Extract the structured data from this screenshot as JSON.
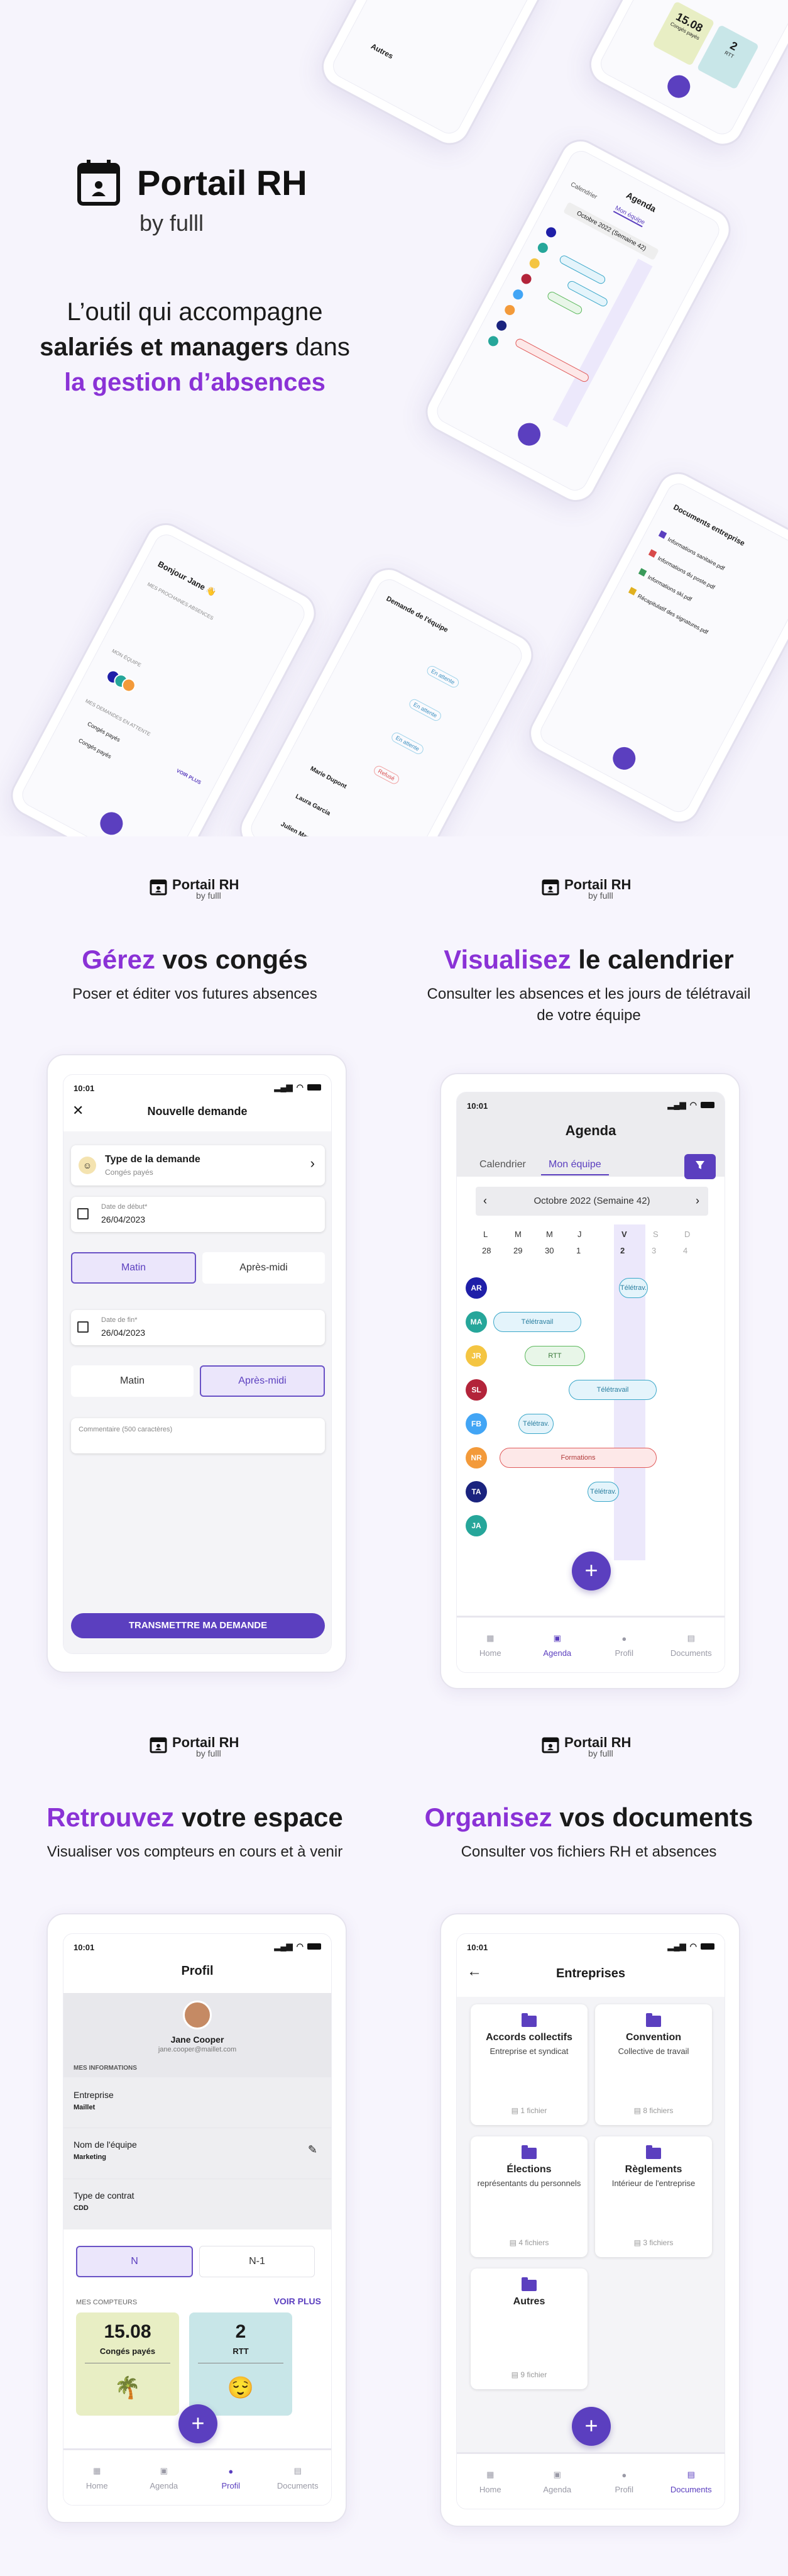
{
  "hero": {
    "brand": "Portail RH",
    "by": "by fulll",
    "tag1": "L’outil qui accompagne",
    "tag2a": "salariés et managers",
    "tag2b": " dans",
    "tag3": "la gestion d’absences",
    "deco": {
      "agenda_title": "Agenda",
      "agenda_tabs": [
        "Calendrier",
        "Mon équipe"
      ],
      "agenda_week": "Octobre 2022 (Semaine 42)",
      "home_greeting": "Bonjour Jane 👋",
      "home_sections": [
        "MES PROCHAINES ABSENCES",
        "MON ÉQUIPE",
        "MES DEMANDES EN ATTENTE"
      ],
      "home_items": [
        "Congés payés",
        "Congés payés",
        "Congés payés"
      ],
      "home_more": "VOIR PLUS",
      "team_title": "Demande de l'équipe",
      "team_names": [
        "Marie Dupont",
        "Laura Garcia",
        "Julien Martin"
      ],
      "team_statuses": [
        "En attente",
        "En attente",
        "En attente",
        "Refusé"
      ],
      "docs_title": "Documents entreprise",
      "docs_files": [
        "Informations sanitaire.pdf",
        "Informations du poste.pdf",
        "Informations ski.pdf",
        "Récapitulatif des signatures.pdf"
      ],
      "counter_top": {
        "value": "15.08",
        "label": "Congés payés",
        "value2": "2",
        "label2": "RTT"
      },
      "top_left_label": "Autres"
    }
  },
  "sections": {
    "conges": {
      "brand": "Portail RH",
      "by": "by fulll",
      "title_accent": "Gérez",
      "title_rest": " vos congés",
      "subtitle": "Poser et éditer vos futures absences"
    },
    "calendrier": {
      "brand": "Portail RH",
      "by": "by fulll",
      "title_accent": "Visualisez",
      "title_rest": " le calendrier",
      "subtitle1": "Consulter les absences et les jours de télétravail",
      "subtitle2": "de votre équipe"
    },
    "espace": {
      "brand": "Portail RH",
      "by": "by fulll",
      "title_accent": "Retrouvez",
      "title_rest": " votre espace",
      "subtitle": "Visualiser vos compteurs en cours et à venir"
    },
    "documents": {
      "brand": "Portail RH",
      "by": "by fulll",
      "title_accent": "Organisez",
      "title_rest": " vos documents",
      "subtitle": "Consulter vos fichiers RH et absences"
    }
  },
  "status_time": "10:01",
  "nav": [
    "Home",
    "Agenda",
    "Profil",
    "Documents"
  ],
  "request": {
    "title": "Nouvelle demande",
    "type_label": "Type de la demande",
    "type_value": "Congés payés",
    "start_label": "Date de début*",
    "start_value": "26/04/2023",
    "start_choice": [
      "Matin",
      "Après-midi"
    ],
    "end_label": "Date de fin*",
    "end_value": "26/04/2023",
    "end_choice": [
      "Matin",
      "Après-midi"
    ],
    "comment_placeholder": "Commentaire (500 caractères)",
    "submit": "TRANSMETTRE MA DEMANDE"
  },
  "agenda": {
    "title": "Agenda",
    "tabs": [
      "Calendrier",
      "Mon équipe"
    ],
    "week": "Octobre 2022 (Semaine 42)",
    "days": [
      "L",
      "M",
      "M",
      "J",
      "V",
      "S",
      "D"
    ],
    "dates": [
      "28",
      "29",
      "30",
      "1",
      "2",
      "3",
      "4"
    ],
    "rows": [
      {
        "initials": "AR",
        "color": "#1f1fa8",
        "label": "Télétrav.",
        "kind": "tele"
      },
      {
        "initials": "MA",
        "color": "#26a69a",
        "label": "Télétravail",
        "kind": "tele"
      },
      {
        "initials": "JR",
        "color": "#f4c542",
        "label": "RTT",
        "kind": "rtt"
      },
      {
        "initials": "SL",
        "color": "#b3243a",
        "label": "Télétravail",
        "kind": "tele"
      },
      {
        "initials": "FB",
        "color": "#42a5f5",
        "label": "Télétrav.",
        "kind": "tele"
      },
      {
        "initials": "NR",
        "color": "#f39a3a",
        "label": "Formations",
        "kind": "form"
      },
      {
        "initials": "TA",
        "color": "#1a237e",
        "label": "Télétrav.",
        "kind": "tele"
      },
      {
        "initials": "JA",
        "color": "#26a69a",
        "label": "",
        "kind": ""
      }
    ]
  },
  "profile": {
    "title": "Profil",
    "name": "Jane Cooper",
    "email": "jane.cooper@maillet.com",
    "section_info": "MES INFORMATIONS",
    "company_label": "Entreprise",
    "company_value": "Maillet",
    "team_label": "Nom de l'équipe",
    "team_value": "Marketing",
    "contract_label": "Type de contrat",
    "contract_value": "CDD",
    "years": [
      "N",
      "N-1"
    ],
    "counters_label": "MES COMPTEURS",
    "more": "VOIR PLUS",
    "counter1_value": "15.08",
    "counter1_label": "Congés payés",
    "counter2_value": "2",
    "counter2_label": "RTT"
  },
  "docs": {
    "title": "Entreprises",
    "cards": [
      {
        "title": "Accords collectifs",
        "sub": "Entreprise et syndicat",
        "count": "1 fichier"
      },
      {
        "title": "Convention",
        "sub": "Collective de travail",
        "count": "8 fichiers"
      },
      {
        "title": "Élections",
        "sub": "représentants du personnels",
        "count": "4 fichiers"
      },
      {
        "title": "Règlements",
        "sub": "Intérieur de l'entreprise",
        "count": "3 fichiers"
      },
      {
        "title": "Autres",
        "sub": "",
        "count": "9 fichier"
      }
    ]
  },
  "colors": {
    "accent": "#8a32d6",
    "primary": "#5b3fbf",
    "green_counter": "#e8eec4",
    "teal_counter": "#c8e6e8"
  }
}
